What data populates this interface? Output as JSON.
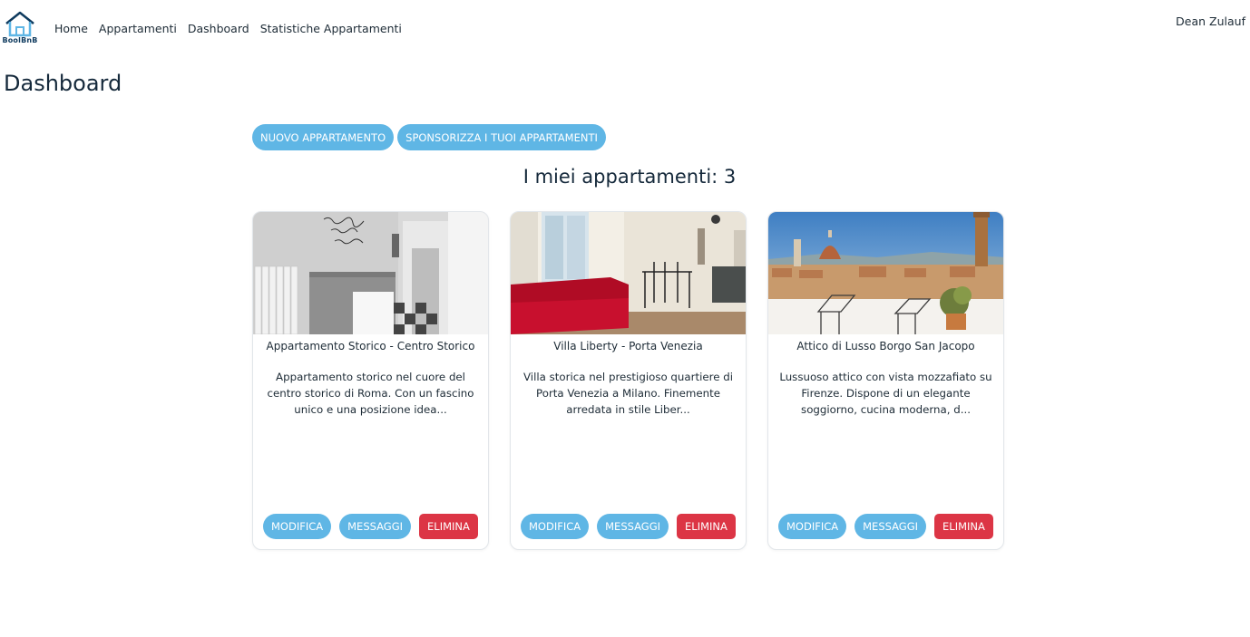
{
  "navbar": {
    "logo_text": "BoolBnB",
    "links": [
      "Home",
      "Appartamenti",
      "Dashboard",
      "Statistiche Appartamenti"
    ],
    "user_name": "Dean Zulauf"
  },
  "page": {
    "title": "Dashboard",
    "new_apartment_label": "NUOVO APPARTAMENTO",
    "sponsor_label": "SPONSORIZZA I TUOI APPARTAMENTI",
    "section_title": "I miei appartamenti: 3"
  },
  "apartments": [
    {
      "title": "Appartamento Storico - Centro Storico",
      "description": "Appartamento storico nel cuore del centro storico di Roma. Con un fascino unico e una posizione idea...",
      "edit_label": "MODIFICA",
      "messages_label": "MESSAGGI",
      "delete_label": "ELIMINA"
    },
    {
      "title": "Villa Liberty - Porta Venezia",
      "description": "Villa storica nel prestigioso quartiere di Porta Venezia a Milano. Finemente arredata in stile Liber...",
      "edit_label": "MODIFICA",
      "messages_label": "MESSAGGI",
      "delete_label": "ELIMINA"
    },
    {
      "title": "Attico di Lusso Borgo San Jacopo",
      "description": "Lussuoso attico con vista mozzafiato su Firenze. Dispone di un elegante soggiorno, cucina moderna, d...",
      "edit_label": "MODIFICA",
      "messages_label": "MESSAGGI",
      "delete_label": "ELIMINA"
    }
  ],
  "colors": {
    "primary_button": "#5fb6e5",
    "danger_button": "#dc3545",
    "text": "#1d2b36"
  }
}
